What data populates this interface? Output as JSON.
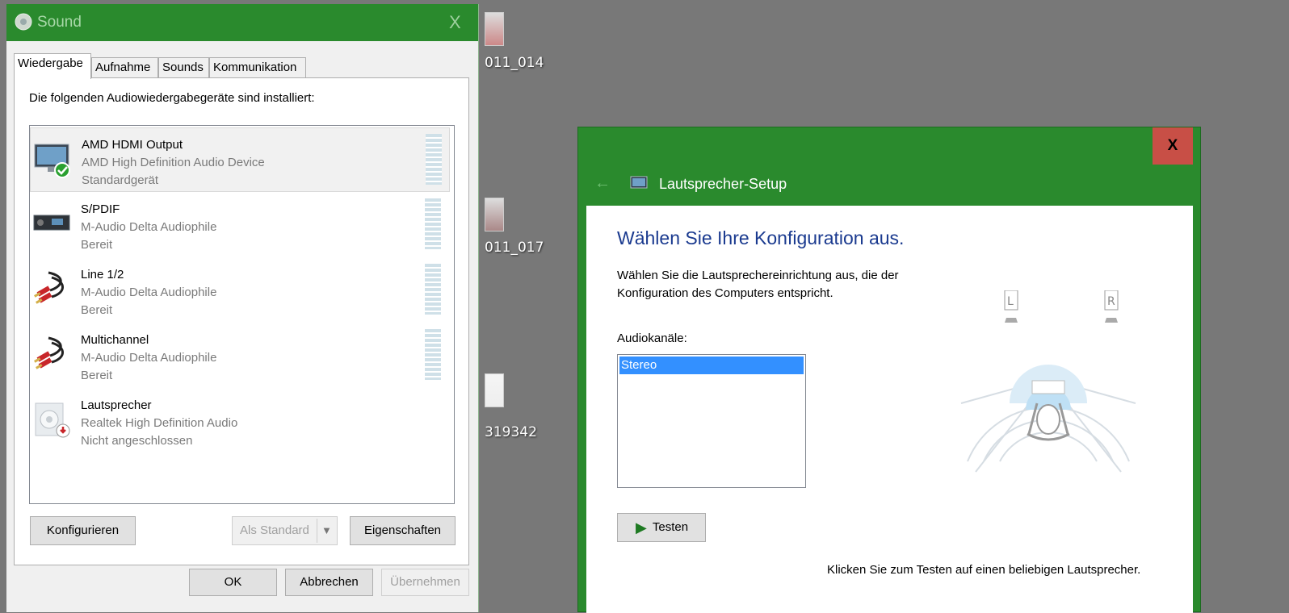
{
  "desktop": {
    "labels": [
      "011_014",
      "011_017",
      "319342"
    ]
  },
  "sound_window": {
    "title": "Sound",
    "close_glyph": "X",
    "tabs": [
      {
        "label": "Wiedergabe",
        "active": true
      },
      {
        "label": "Aufnahme",
        "active": false
      },
      {
        "label": "Sounds",
        "active": false
      },
      {
        "label": "Kommunikation",
        "active": false
      }
    ],
    "intro": "Die folgenden Audiowiedergabegeräte sind installiert:",
    "devices": [
      {
        "name": "AMD HDMI Output",
        "description": "AMD High Definition Audio Device",
        "status": "Standardgerät",
        "icon": "monitor-icon",
        "selected": true
      },
      {
        "name": "S/PDIF",
        "description": "M-Audio Delta Audiophile",
        "status": "Bereit",
        "icon": "receiver-icon",
        "selected": false
      },
      {
        "name": "Line 1/2",
        "description": "M-Audio Delta Audiophile",
        "status": "Bereit",
        "icon": "rca-cable-icon",
        "selected": false
      },
      {
        "name": "Multichannel",
        "description": "M-Audio Delta Audiophile",
        "status": "Bereit",
        "icon": "rca-cable-icon",
        "selected": false
      },
      {
        "name": "Lautsprecher",
        "description": "Realtek High Definition Audio",
        "status": "Nicht angeschlossen",
        "icon": "speaker-icon",
        "selected": false
      }
    ],
    "buttons": {
      "configure": "Konfigurieren",
      "set_default": "Als Standard",
      "properties": "Eigenschaften",
      "ok": "OK",
      "cancel": "Abbrechen",
      "apply": "Übernehmen"
    }
  },
  "setup_window": {
    "title": "Lautsprecher-Setup",
    "close_glyph": "X",
    "heading": "Wählen Sie Ihre Konfiguration aus.",
    "description": "Wählen Sie die Lautsprechereinrichtung aus, die der Konfiguration des Computers entspricht.",
    "channels_label": "Audiokanäle:",
    "channels": [
      "Stereo"
    ],
    "selected_channel": "Stereo",
    "test_button": "Testen",
    "speaker_labels": {
      "left": "L",
      "right": "R"
    },
    "hint": "Klicken Sie zum Testen auf einen beliebigen Lautsprecher.",
    "colors": {
      "titlebar": "#2a8a2d",
      "close": "#c84f46",
      "heading": "#1a3a8f"
    }
  }
}
